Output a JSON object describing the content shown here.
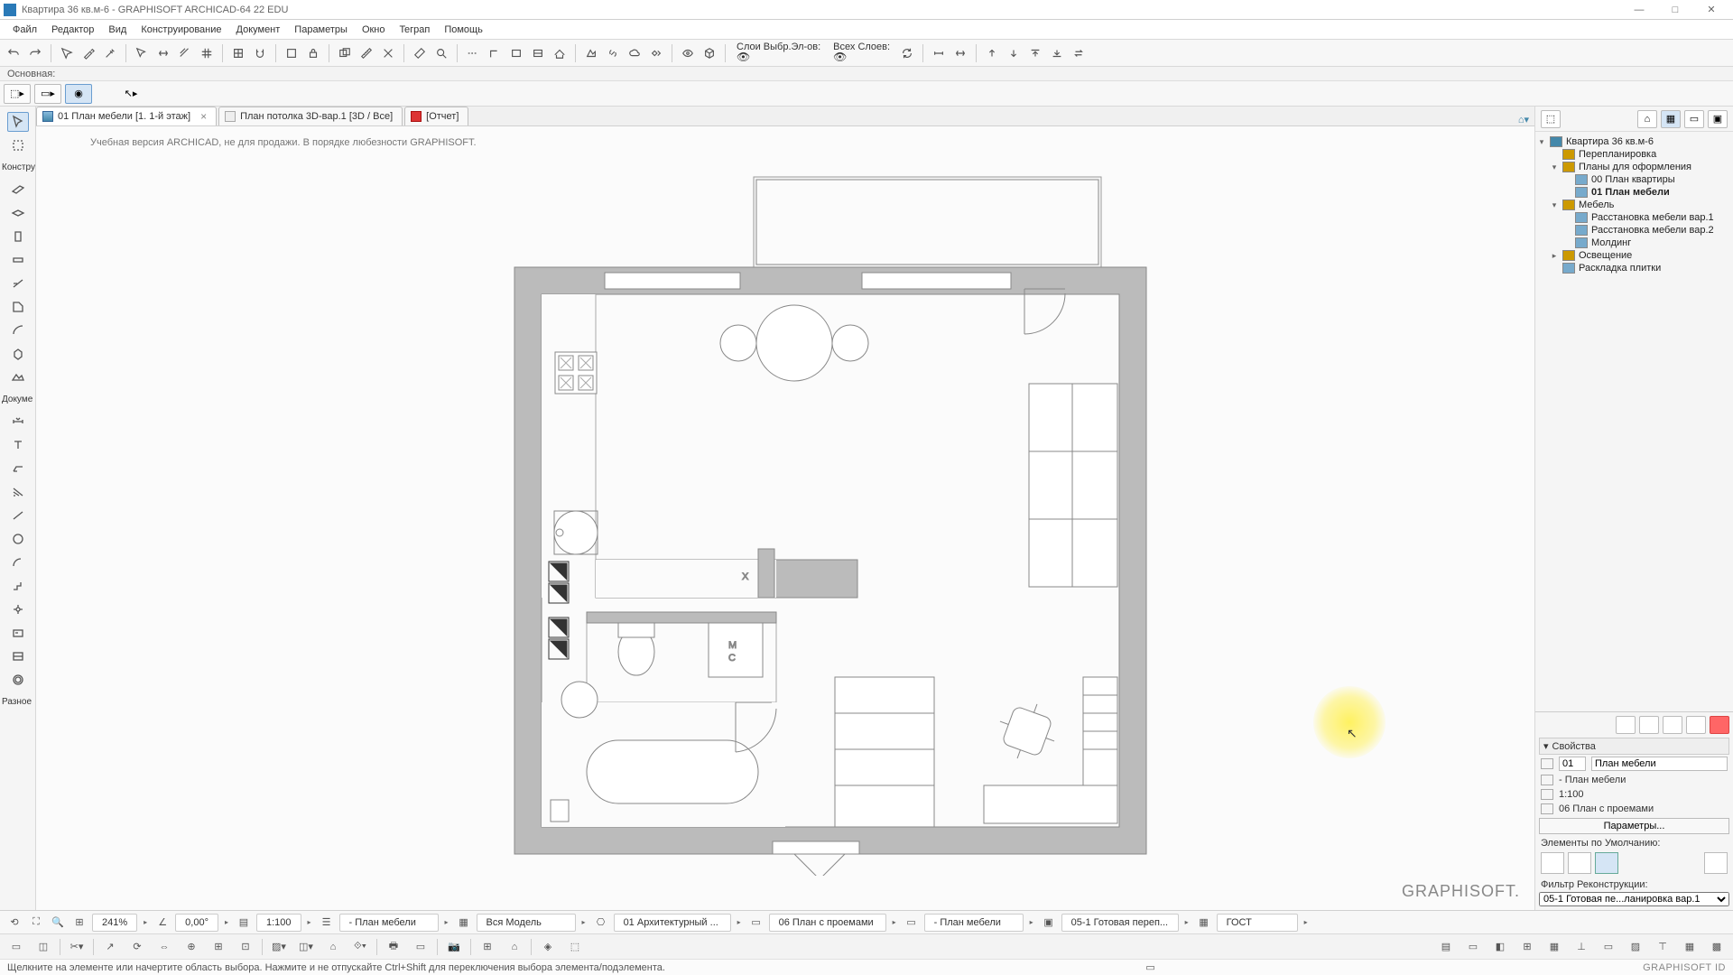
{
  "title": "Квартира 36 кв.м-6 - GRAPHISOFT ARCHICAD-64 22 EDU",
  "menu": [
    "Файл",
    "Редактор",
    "Вид",
    "Конструирование",
    "Документ",
    "Параметры",
    "Окно",
    "Teграп",
    "Помощь"
  ],
  "toolbar_labels": {
    "layer_sel": "Слои Выбр.Эл-ов:",
    "layers_all": "Всех Слоев:"
  },
  "thinbar": "Основная:",
  "tabs": [
    {
      "label": "01 План мебели [1. 1-й этаж]",
      "active": true,
      "closable": true
    },
    {
      "label": "План потолка 3D-вар.1 [3D / Все]",
      "active": false,
      "closable": false
    },
    {
      "label": "[Отчет]",
      "active": false,
      "closable": false,
      "red": true
    }
  ],
  "watermark": "Учебная версия ARCHICAD, не для продажи. В порядке любезности GRAPHISOFT.",
  "left_sections": {
    "constr": "Констру",
    "docs": "Докуме",
    "misc": "Разное"
  },
  "tree": [
    {
      "d": 0,
      "tw": "▾",
      "icon": "home",
      "label": "Квартира 36 кв.м-6"
    },
    {
      "d": 1,
      "tw": "",
      "icon": "folder",
      "label": "Перепланировка"
    },
    {
      "d": 1,
      "tw": "▾",
      "icon": "folder",
      "label": "Планы для оформления"
    },
    {
      "d": 2,
      "tw": "",
      "icon": "sheet",
      "label": "00 План квартиры"
    },
    {
      "d": 2,
      "tw": "",
      "icon": "sheet",
      "label": "01 План мебели",
      "sel": true
    },
    {
      "d": 1,
      "tw": "▾",
      "icon": "folder",
      "label": "Мебель"
    },
    {
      "d": 2,
      "tw": "",
      "icon": "sheet",
      "label": "Расстановка мебели вар.1"
    },
    {
      "d": 2,
      "tw": "",
      "icon": "sheet",
      "label": "Расстановка мебели вар.2"
    },
    {
      "d": 2,
      "tw": "",
      "icon": "sheet",
      "label": "Молдинг"
    },
    {
      "d": 1,
      "tw": "▸",
      "icon": "folder",
      "label": "Освещение"
    },
    {
      "d": 1,
      "tw": "",
      "icon": "sheet",
      "label": "Раскладка плитки"
    }
  ],
  "props": {
    "header": "Свойства",
    "id": "01",
    "name": "План мебели",
    "template": "- План мебели",
    "scale": "1:100",
    "plan": "06 План с проемами",
    "params_btn": "Параметры...",
    "defaults_label": "Элементы по Умолчанию:",
    "filter_label": "Фильтр Реконструкции:",
    "filter_value": "05-1 Готовая пе...ланировка вар.1"
  },
  "status": {
    "zoom": "241%",
    "angle": "0,00°",
    "scale": "1:100",
    "layer": "- План мебели",
    "model": "Вся Модель",
    "arch": "01 Архитектурный ...",
    "plan": "06 План с проемами",
    "plan2": "- План мебели",
    "ready": "05-1 Готовая переп...",
    "std": "ГОСТ"
  },
  "hint": "Щелкните на элементе или начертите область выбора. Нажмите и не отпускайте Ctrl+Shift для переключения выбора элемента/подэлемента.",
  "brand": "GRAPHISOFT.",
  "brand2": "GRAPHISOFT ID",
  "plan_marker": "X",
  "chart_data": null
}
